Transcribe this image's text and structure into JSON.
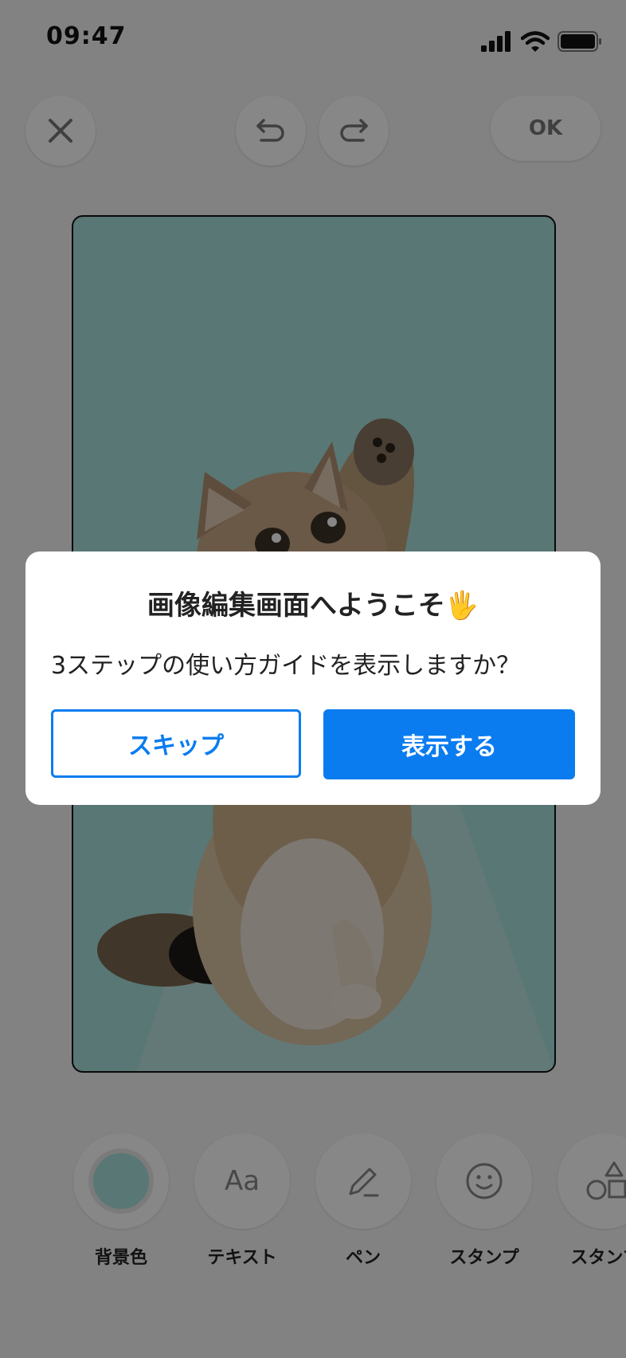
{
  "status_bar": {
    "time": "09:47"
  },
  "toolbar": {
    "close_icon": "close-icon",
    "undo_icon": "undo-icon",
    "redo_icon": "redo-icon",
    "ok_label": "OK"
  },
  "canvas": {
    "background_color": "#a8e0dc"
  },
  "tools": [
    {
      "label": "背景色",
      "icon": "color-circle-icon"
    },
    {
      "label": "テキスト",
      "icon": "text-aa-icon",
      "glyph": "Aa"
    },
    {
      "label": "ペン",
      "icon": "pen-icon"
    },
    {
      "label": "スタンプ",
      "icon": "smiley-icon"
    },
    {
      "label": "スタンプ",
      "icon": "shapes-icon"
    }
  ],
  "dialog": {
    "title": "画像編集画面へようこそ",
    "title_emoji": "🖐",
    "message": "3ステップの使い方ガイドを表示しますか？",
    "skip_label": "スキップ",
    "show_label": "表示する"
  },
  "colors": {
    "accent": "#0a7cf0",
    "overlay": "rgba(0,0,0,0.47)"
  }
}
